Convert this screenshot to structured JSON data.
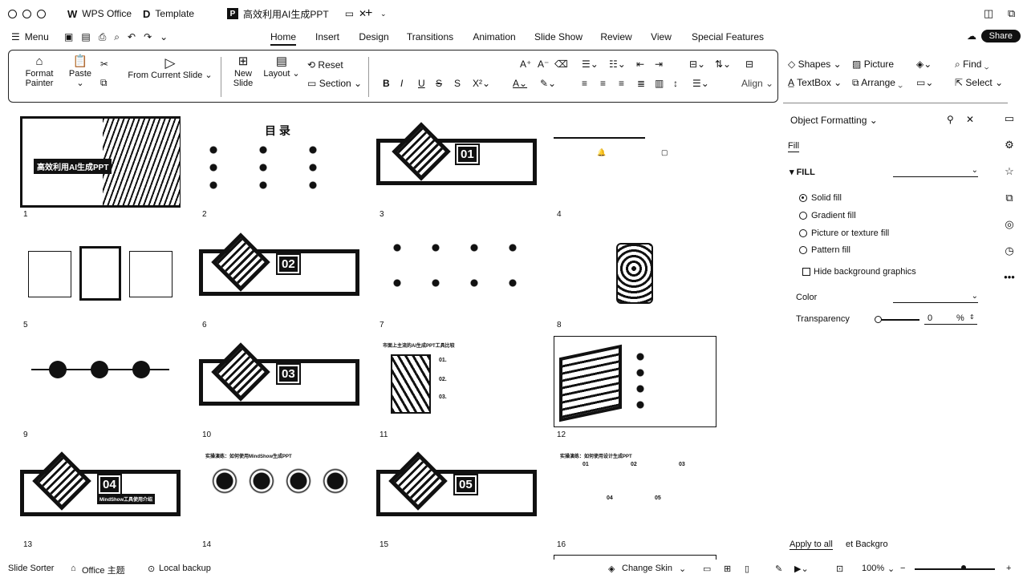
{
  "tabs": [
    {
      "label": "WPS Office",
      "icon": "wps-logo-icon"
    },
    {
      "label": "Template",
      "icon": "template-icon"
    },
    {
      "label": "高效利用AI生成PPT",
      "icon": "ppt-doc-icon"
    }
  ],
  "menu": {
    "label": "Menu"
  },
  "ribbon_tabs": [
    "Home",
    "Insert",
    "Design",
    "Transitions",
    "Animation",
    "Slide Show",
    "Review",
    "View",
    "Special Features"
  ],
  "active_tab": "Home",
  "share": "Share",
  "toolbar": {
    "format_painter": "Format Painter",
    "paste": "Paste",
    "from_current_slide": "From Current Slide",
    "new_slide": "New Slide",
    "layout": "Layout",
    "reset": "Reset",
    "section": "Section",
    "align": "Align",
    "shapes": "Shapes",
    "picture": "Picture",
    "find": "Find",
    "textbox": "TextBox",
    "arrange": "Arrange",
    "select": "Select"
  },
  "slides": {
    "n1": "1",
    "n2": "2",
    "n3": "3",
    "n4": "4",
    "n5": "5",
    "n6": "6",
    "n7": "7",
    "n8": "8",
    "n9": "9",
    "n10": "10",
    "n11": "11",
    "n12": "12",
    "n13": "13",
    "n14": "14",
    "n15": "15",
    "n16": "16",
    "s1_title": "高效利用AI生成PPT",
    "s2_title": "目 录",
    "s3_num": "01",
    "s6_num": "02",
    "s10_num": "03",
    "s13_num": "04",
    "s13_label": "MindShow工具使用介绍",
    "s15_num": "05",
    "s14_title": "实操演练：如何使用MindShow生成PPT",
    "s11_title": "市面上主流的AI生成PPT工具比较",
    "s11_items": [
      "01.",
      "02.",
      "03."
    ],
    "s16_title": "实操演练：如何使用设计生成PPT",
    "s16_items": [
      "01",
      "02",
      "03",
      "04",
      "05"
    ]
  },
  "panel": {
    "title": "Object Formatting",
    "tab": "Fill",
    "section": "FILL",
    "options": [
      "Solid fill",
      "Gradient fill",
      "Picture or texture fill",
      "Pattern fill"
    ],
    "hide_bg": "Hide background graphics",
    "color_label": "Color",
    "transparency_label": "Transparency",
    "transparency_value": "0",
    "transparency_unit": "%",
    "apply_all": "Apply to all",
    "reset_bg": "et Backgro"
  },
  "status": {
    "slide_sorter": "Slide Sorter",
    "theme": "Office 主题",
    "backup": "Local backup",
    "change_skin": "Change Skin",
    "zoom": "100%"
  }
}
